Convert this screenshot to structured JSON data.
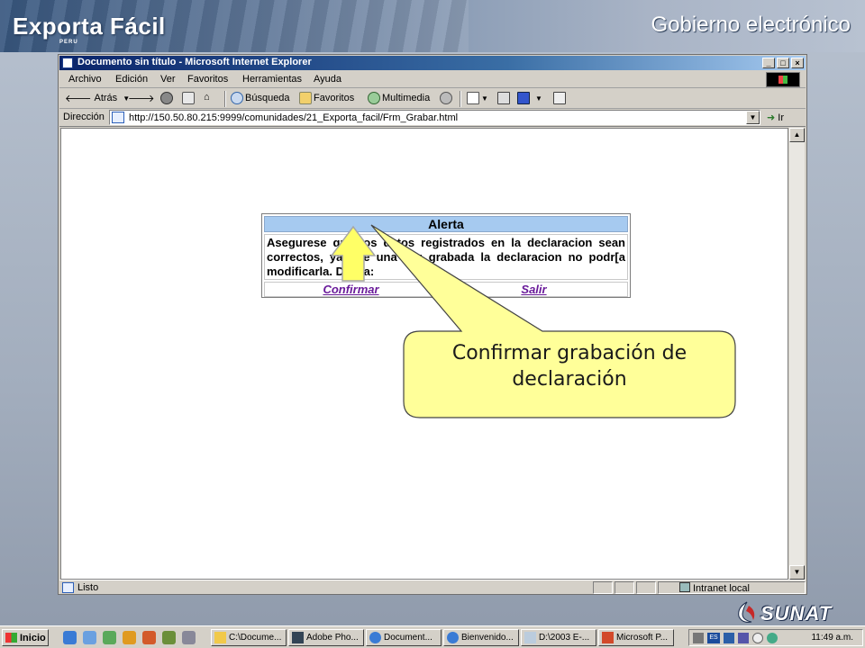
{
  "slide": {
    "title": "Exporta Fácil",
    "peru_mark": "PERU",
    "subtitle": "Gobierno electrónico",
    "brand_logo_text": "SUNAT"
  },
  "browser": {
    "window_title": "Documento sin título - Microsoft Internet Explorer",
    "menu": [
      "Archivo",
      "Edición",
      "Ver",
      "Favoritos",
      "Herramientas",
      "Ayuda"
    ],
    "toolbar": {
      "back": "Atrás",
      "search": "Búsqueda",
      "favorites": "Favoritos",
      "media": "Multimedia"
    },
    "address_label": "Dirección",
    "address_url": "http://150.50.80.215:9999/comunidades/21_Exporta_facil/Frm_Grabar.html",
    "go_label": "Ir",
    "status_text": "Listo",
    "zone_text": "Intranet local"
  },
  "alert": {
    "title": "Alerta",
    "message": "Asegurese que los datos registrados en la declaracion sean correctos, ya que una vez grabada la declaracion no podr[a modificarla. Desea:",
    "confirm_label": "Confirmar",
    "exit_label": "Salir"
  },
  "callout": {
    "text": "Confirmar grabación de declaración"
  },
  "taskbar": {
    "start_label": "Inicio",
    "tasks": [
      "C:\\Docume...",
      "Adobe Pho...",
      "Document...",
      "Bienvenido...",
      "D:\\2003 E-...",
      "Microsoft P..."
    ],
    "language": "ES",
    "clock": "11:49 a.m."
  },
  "colors": {
    "alert_header": "#a6caf0",
    "link": "#6a1b9a",
    "callout_fill": "#ffff99",
    "arrow_fill": "#ffff66",
    "titlebar": "#0a246a"
  }
}
